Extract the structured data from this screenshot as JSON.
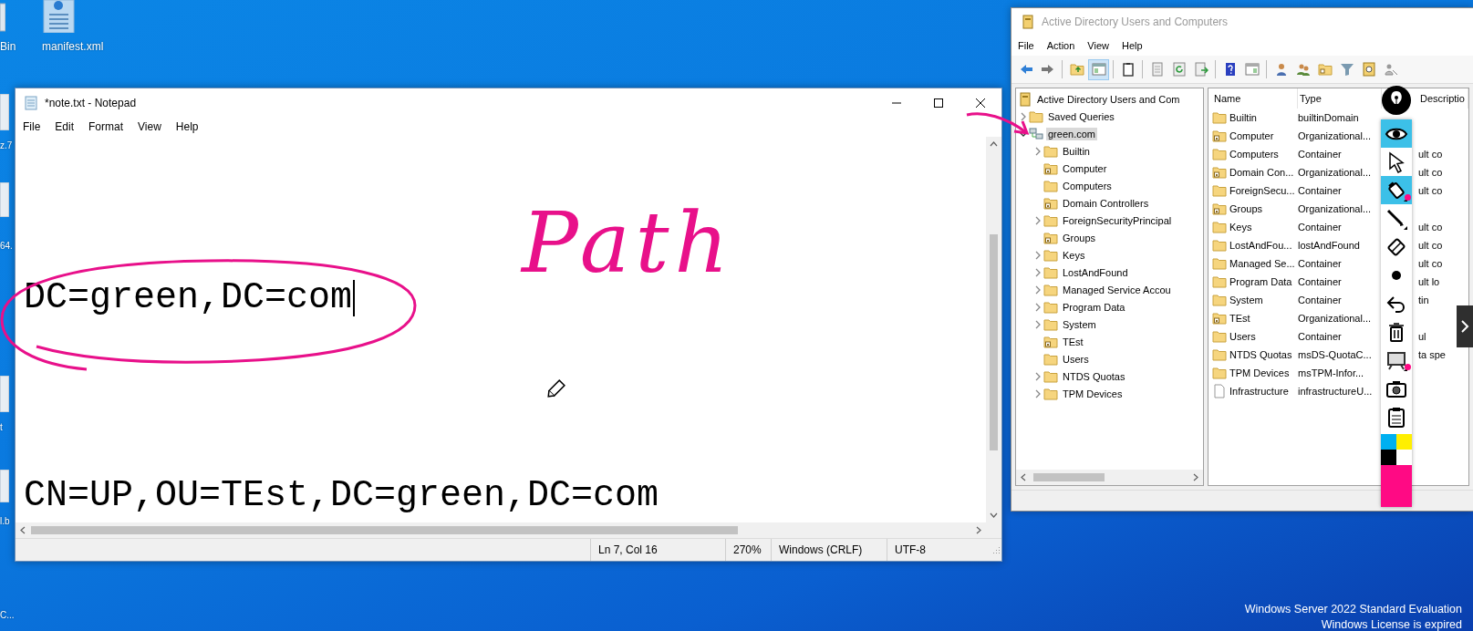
{
  "desktop": {
    "icons": [
      {
        "label": "Bin",
        "kind": "recycle"
      },
      {
        "label": "manifest.xml",
        "kind": "xml"
      },
      {
        "label": "z.7",
        "kind": "file"
      },
      {
        "label": "64.",
        "kind": "file"
      },
      {
        "label": "t",
        "kind": "file"
      },
      {
        "label": "l.b",
        "kind": "file"
      },
      {
        "label": "C...",
        "kind": "none"
      }
    ],
    "watermark": [
      "Windows Server 2022 Standard Evaluation",
      "Windows License is expired"
    ]
  },
  "notepad": {
    "title": "*note.txt - Notepad",
    "menu": [
      "File",
      "Edit",
      "Format",
      "View",
      "Help"
    ],
    "lines": [
      {
        "text": "DC=green,DC=com",
        "caret": true
      },
      {
        "text": "CN=UP,OU=TEst,DC=green,DC=com",
        "caret": false
      }
    ],
    "status": [
      "Ln 7, Col 16",
      "270%",
      "Windows (CRLF)",
      "UTF-8"
    ]
  },
  "annotations": {
    "handwriting": "Path"
  },
  "aduc": {
    "title": "Active Directory Users and Computers",
    "menu": [
      "File",
      "Action",
      "View",
      "Help"
    ],
    "toolbar": [
      {
        "selected": false
      },
      {
        "selected": false
      },
      {
        "selected": false
      },
      {
        "selected": true
      },
      {
        "selected": false
      },
      {
        "selected": false
      },
      {
        "selected": false
      },
      {
        "selected": false
      },
      {
        "selected": false
      },
      {
        "selected": false
      },
      {
        "selected": false
      },
      {
        "selected": false
      },
      {
        "selected": false
      },
      {
        "selected": false
      },
      {
        "selected": false
      },
      {
        "selected": false
      }
    ],
    "tree": [
      {
        "label": "Active Directory Users and Com",
        "kind": "root",
        "selected": false,
        "children": [
          {
            "label": "Saved Queries",
            "kind": "container",
            "expanded": false,
            "selected": false
          },
          {
            "label": "green.com",
            "kind": "domain",
            "expanded": true,
            "selected": true,
            "children": [
              {
                "label": "Builtin",
                "kind": "container",
                "expanded": false,
                "selected": false
              },
              {
                "label": "Computer",
                "kind": "ou",
                "selected": false
              },
              {
                "label": "Computers",
                "kind": "container",
                "selected": false
              },
              {
                "label": "Domain Controllers",
                "kind": "ou",
                "selected": false
              },
              {
                "label": "ForeignSecurityPrincipal",
                "kind": "container",
                "expanded": false,
                "selected": false
              },
              {
                "label": "Groups",
                "kind": "ou",
                "selected": false
              },
              {
                "label": "Keys",
                "kind": "container",
                "expanded": false,
                "selected": false
              },
              {
                "label": "LostAndFound",
                "kind": "container",
                "expanded": false,
                "selected": false
              },
              {
                "label": "Managed Service Accou",
                "kind": "container",
                "expanded": false,
                "selected": false
              },
              {
                "label": "Program Data",
                "kind": "container",
                "expanded": false,
                "selected": false
              },
              {
                "label": "System",
                "kind": "container",
                "expanded": false,
                "selected": false
              },
              {
                "label": "TEst",
                "kind": "ou",
                "selected": false
              },
              {
                "label": "Users",
                "kind": "container",
                "selected": false
              },
              {
                "label": "NTDS Quotas",
                "kind": "container",
                "expanded": false,
                "selected": false
              },
              {
                "label": "TPM Devices",
                "kind": "container",
                "expanded": false,
                "selected": false
              }
            ]
          }
        ]
      }
    ],
    "columns": [
      "Name",
      "Type",
      "Descriptio"
    ],
    "rows": [
      {
        "kind": "container",
        "name": "Builtin",
        "type": "builtinDomain"
      },
      {
        "kind": "ou",
        "name": "Computer",
        "type": "Organizational..."
      },
      {
        "kind": "container",
        "name": "Computers",
        "type": "Container",
        "description": "ult co"
      },
      {
        "kind": "ou",
        "name": "Domain Con...",
        "type": "Organizational...",
        "description": "ult co"
      },
      {
        "kind": "container",
        "name": "ForeignSecu...",
        "type": "Container",
        "description": "ult co"
      },
      {
        "kind": "ou",
        "name": "Groups",
        "type": "Organizational..."
      },
      {
        "kind": "container",
        "name": "Keys",
        "type": "Container",
        "description": "ult co"
      },
      {
        "kind": "container",
        "name": "LostAndFou...",
        "type": "lostAndFound",
        "description": "ult co"
      },
      {
        "kind": "container",
        "name": "Managed Se...",
        "type": "Container",
        "description": "ult co"
      },
      {
        "kind": "container",
        "name": "Program Data",
        "type": "Container",
        "description": "ult lo"
      },
      {
        "kind": "container",
        "name": "System",
        "type": "Container",
        "description": "tin"
      },
      {
        "kind": "ou",
        "name": "TEst",
        "type": "Organizational..."
      },
      {
        "kind": "container",
        "name": "Users",
        "type": "Container",
        "description": "ul"
      },
      {
        "kind": "container",
        "name": "NTDS Quotas",
        "type": "msDS-QuotaC...",
        "description": "ta spe"
      },
      {
        "kind": "container",
        "name": "TPM Devices",
        "type": "msTPM-Infor..."
      },
      {
        "kind": "file",
        "name": "Infrastructure",
        "type": "infrastructureU..."
      }
    ]
  },
  "annotation_toolbar": {
    "tools": [
      {
        "selected": true,
        "marked": false
      },
      {
        "selected": false,
        "marked": false
      },
      {
        "selected": true,
        "marked": true
      },
      {
        "selected": false,
        "marked": false
      },
      {
        "selected": false,
        "marked": false
      },
      {
        "selected": false,
        "marked": false
      },
      {
        "selected": false,
        "marked": false
      },
      {
        "selected": false,
        "marked": false
      },
      {
        "selected": false,
        "marked": true
      },
      {
        "selected": false,
        "marked": false
      },
      {
        "selected": false,
        "marked": false
      }
    ],
    "colors": [
      {
        "color": "#00b0f0",
        "selected": false
      },
      {
        "color": "#ffef00",
        "selected": false
      },
      {
        "color": "#000000",
        "selected": false
      },
      {
        "color": "#ff0a84",
        "selected": true
      }
    ]
  }
}
